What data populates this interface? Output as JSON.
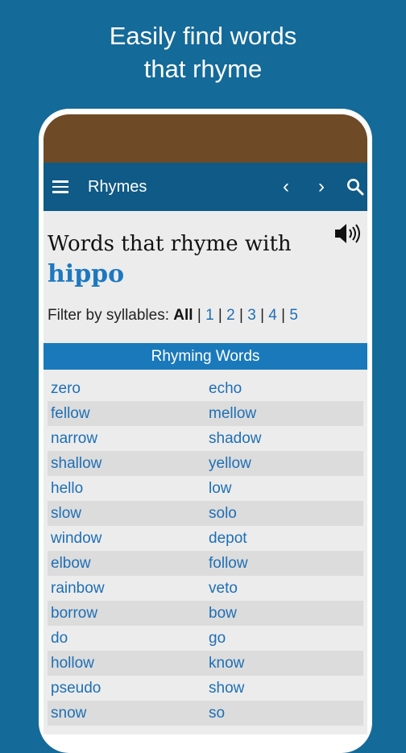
{
  "headline": [
    "Easily find words",
    "that rhyme"
  ],
  "appbar": {
    "title": "Rhymes",
    "prev_icon": "‹",
    "next_icon": "›"
  },
  "heading": "Words that rhyme with",
  "keyword": "hippo",
  "filter": {
    "label": "Filter by syllables:",
    "all": "All",
    "options": [
      "1",
      "2",
      "3",
      "4",
      "5"
    ]
  },
  "section_title": "Rhyming Words",
  "rows": [
    [
      "zero",
      "echo"
    ],
    [
      "fellow",
      "mellow"
    ],
    [
      "narrow",
      "shadow"
    ],
    [
      "shallow",
      "yellow"
    ],
    [
      "hello",
      "low"
    ],
    [
      "slow",
      "solo"
    ],
    [
      "window",
      "depot"
    ],
    [
      "elbow",
      "follow"
    ],
    [
      "rainbow",
      "veto"
    ],
    [
      "borrow",
      "bow"
    ],
    [
      "do",
      "go"
    ],
    [
      "hollow",
      "know"
    ],
    [
      "pseudo",
      "show"
    ],
    [
      "snow",
      "so"
    ]
  ],
  "icons": [
    "menu-icon",
    "chevron-left-icon",
    "chevron-right-icon",
    "search-icon",
    "speaker-icon"
  ],
  "colors": {
    "background": "#146a99",
    "appbar": "#0f5a86",
    "statusbar": "#6f4a26",
    "section": "#1a79bb",
    "link": "#1e6fb5",
    "keyword": "#1d78c0"
  }
}
